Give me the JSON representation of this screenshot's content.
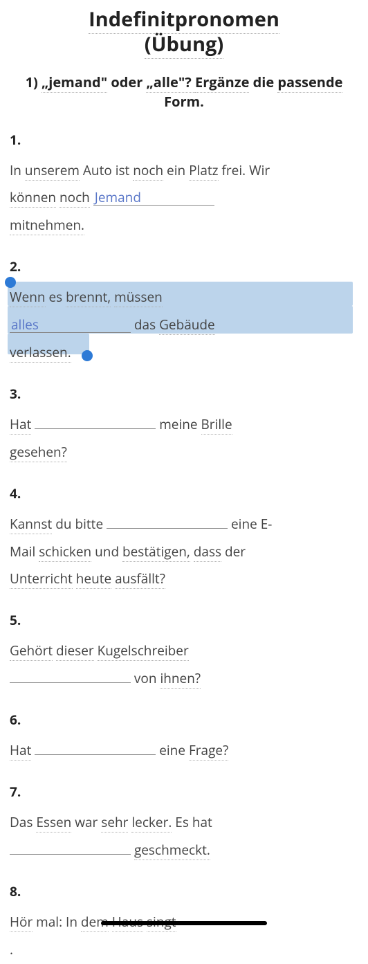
{
  "title_line1": "Indefinitpronomen",
  "title_line2": "(Übung)",
  "instruction_prefix": "1) ",
  "instruction_q1": "„jemand\"",
  "instruction_mid": " oder ",
  "instruction_q2": "„alle\"? ",
  "instruction_w1": "Ergänze",
  "instruction_w2": " die ",
  "instruction_w3": "passende",
  "instruction_w4": " Form.",
  "q1": {
    "num": "1.",
    "t1": "In ",
    "t2": "unserem",
    "t3": " Auto ist ",
    "t4": "noch",
    "t5": " ein ",
    "t6": "Platz",
    "t7": " frei. Wir ",
    "t8": "können",
    "t9": " ",
    "t10": "noch",
    "blank": "Jemand",
    "t11": "mitnehmen."
  },
  "q2": {
    "num": "2.",
    "t1": "Wenn",
    "t2": " es ",
    "t3": "brennt,",
    "t4": " ",
    "t5": "müssen",
    "blank": "alles",
    "t6": " das ",
    "t7": "Gebäude",
    "t8": "verlassen."
  },
  "q3": {
    "num": "3.",
    "t1": "Hat",
    "blank": "",
    "t2": " meine ",
    "t3": "Brille",
    "t4": "gesehen?"
  },
  "q4": {
    "num": "4.",
    "t1": "Kannst",
    "t2": " du bitte",
    "blank": "",
    "t3": " eine E-",
    "t4": "Mail ",
    "t5": "schicken",
    "t6": " und ",
    "t7": "bestätigen,",
    "t8": " ",
    "t9": "dass",
    "t10": " der ",
    "t11": "Unterricht",
    "t12": " ",
    "t13": "heute",
    "t14": " ",
    "t15": "ausfällt?"
  },
  "q5": {
    "num": "5.",
    "t1": "Gehört",
    "t2": " ",
    "t3": "dieser",
    "t4": " ",
    "t5": "Kugelschreiber",
    "blank": "",
    "t6": " von ",
    "t7": "ihnen?"
  },
  "q6": {
    "num": "6.",
    "t1": "Hat",
    "blank": "",
    "t2": " eine ",
    "t3": "Frage?"
  },
  "q7": {
    "num": "7.",
    "t1": "Das ",
    "t2": "Essen",
    "t3": " war ",
    "t4": "sehr",
    "t5": " ",
    "t6": "lecker.",
    "t7": " Es hat",
    "blank": "",
    "t8": " ",
    "t9": "geschmeckt."
  },
  "q8": {
    "num": "8.",
    "t1": "Hör",
    "t2": " mal: In ",
    "t3": "dem",
    "t4": " ",
    "t5": "Haus",
    "t6": " ",
    "t7": "singt",
    "t8": " ."
  }
}
